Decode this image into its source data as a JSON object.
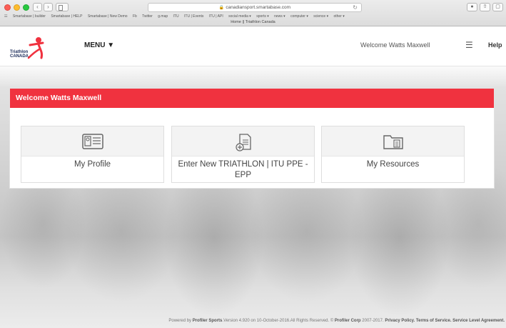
{
  "browser": {
    "url": "canadiansport.smartabase.com",
    "tab_title": "Home || Triathlon Canada",
    "bookmarks": [
      "Smartabase | builder",
      "Smartabase | HELP",
      "Smartabase | New Demo",
      "Fb",
      "Twitter",
      "g.map",
      "ITU",
      "ITU | Events",
      "ITU | API",
      "social media ▾",
      "sports ▾",
      "news ▾",
      "computer ▾",
      "science ▾",
      "other ▾"
    ]
  },
  "header": {
    "logo_line1": "Triathlon",
    "logo_line2": "CANADA",
    "menu_label": "MENU ▼",
    "welcome_text": "Welcome Watts Maxwell",
    "help_label": "Help"
  },
  "panel": {
    "title": "Welcome Watts Maxwell",
    "tiles": [
      {
        "label": "My Profile",
        "icon": "profile-card-icon"
      },
      {
        "label": "Enter New TRIATHLON | ITU PPE - EPP",
        "icon": "new-document-icon"
      },
      {
        "label": "My Resources",
        "icon": "folder-icon"
      }
    ]
  },
  "footer": {
    "prefix": "Powered by",
    "brand": "Profiler Sports",
    "version_text": ".Version 4.920 on 10-October-2016.All Rights Reserved. ©",
    "corp": "Profiler Corp",
    "years": "2007-2017.",
    "privacy": "Privacy Policy.",
    "terms": "Terms of Service.",
    "sla": "Service Level Agreement."
  },
  "colors": {
    "accent_red": "#f0323f",
    "logo_navy": "#1a2b5a"
  }
}
